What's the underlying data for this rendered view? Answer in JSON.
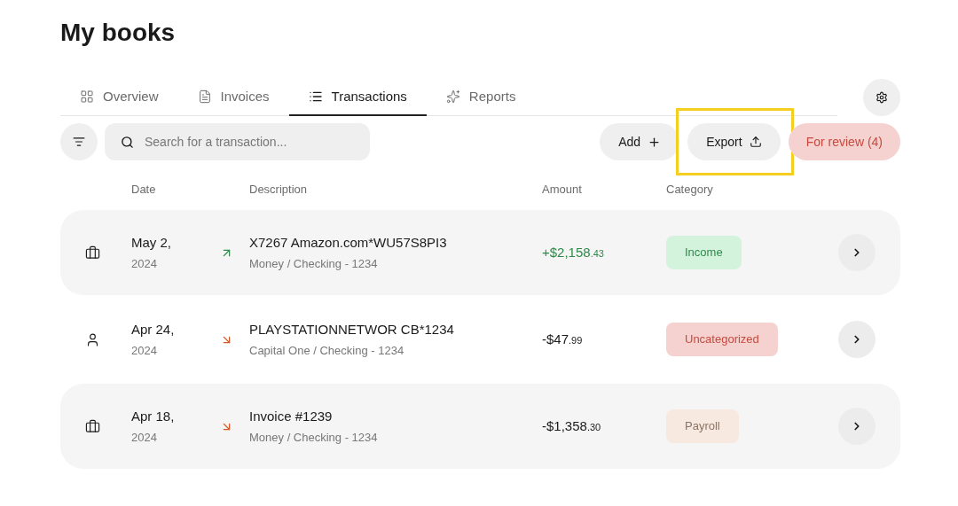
{
  "title": "My books",
  "tabs": [
    {
      "label": "Overview",
      "selected": false
    },
    {
      "label": "Invoices",
      "selected": false
    },
    {
      "label": "Transactions",
      "selected": true
    },
    {
      "label": "Reports",
      "selected": false
    }
  ],
  "search": {
    "placeholder": "Search for a transaction..."
  },
  "actions": [
    {
      "label": "Add",
      "kind": "add",
      "highlighted": false
    },
    {
      "label": "Export",
      "kind": "export",
      "highlighted": true
    },
    {
      "label": "For review (4)",
      "kind": "review",
      "highlighted": false
    }
  ],
  "columns": [
    "Date",
    "Description",
    "Amount",
    "Category"
  ],
  "rows": [
    {
      "kind": "business_in",
      "date": "May 2,",
      "year": "2024",
      "description": "X7267 Amazon.com*WU57S8PI3",
      "account": "Money / Checking - 1234",
      "amount": "+$2,158$_{.43}$",
      "category": "Income",
      "color": "#d4f3dd"
    },
    {
      "kind": "personal_out",
      "date": "Apr 24,",
      "year": "2024",
      "description": "PLAYSTATIONNETWOR CB*1234",
      "account": "Capital One / Checking - 1234",
      "amount": "-$47$_{.99}$",
      "category": "Uncategorized",
      "color": "#f5d2cf"
    },
    {
      "kind": "business_out",
      "date": "Apr 18,",
      "year": "2024",
      "description": "Invoice #1239",
      "account": "Money / Checking - 1234",
      "amount": "-$1,358$_{.30}$",
      "category": "Payroll",
      "color": "#f7e9e0"
    }
  ]
}
